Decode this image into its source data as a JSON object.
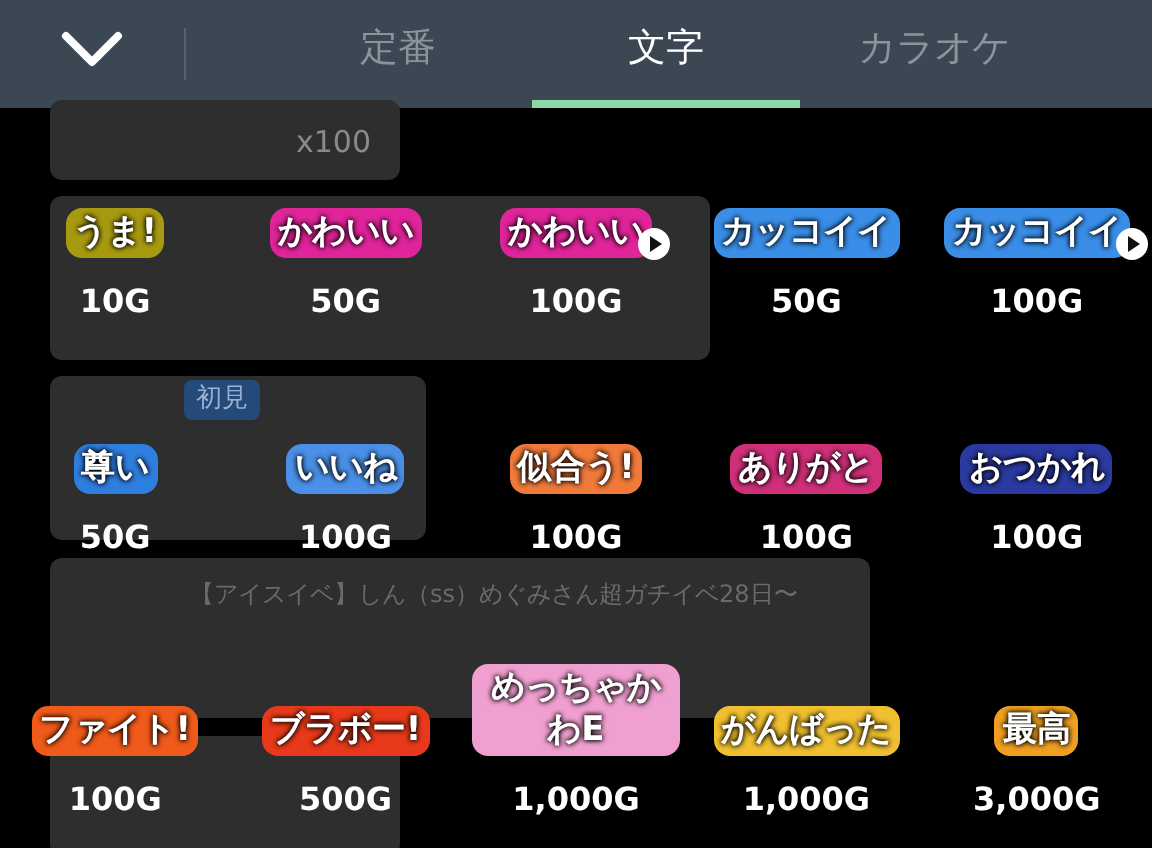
{
  "header": {
    "tabs": [
      {
        "label": "定番",
        "selected": false
      },
      {
        "label": "文字",
        "selected": true
      },
      {
        "label": "カラオケ",
        "selected": false
      }
    ]
  },
  "background_comments": [
    {
      "kind": "count",
      "text": "x100"
    },
    {
      "kind": "badge",
      "text": "初見"
    },
    {
      "kind": "comment",
      "text": "【アイスイベ】しん（ss）めぐみさん超ガチイベ28日〜"
    }
  ],
  "gifts": [
    {
      "sticker": "うま!",
      "color": "#a89a10",
      "price": "10G",
      "preview": false
    },
    {
      "sticker": "かわいい",
      "color": "#e0249a",
      "price": "50G",
      "preview": false
    },
    {
      "sticker": "かわいい",
      "color": "#e0249a",
      "price": "100G",
      "preview": true
    },
    {
      "sticker": "カッコイイ",
      "color": "#3a8ee8",
      "price": "50G",
      "preview": false
    },
    {
      "sticker": "カッコイイ",
      "color": "#3a8ee8",
      "price": "100G",
      "preview": true
    },
    {
      "sticker": "尊い",
      "color": "#2f7fe0",
      "price": "50G",
      "preview": false
    },
    {
      "sticker": "いいね",
      "color": "#4a90e8",
      "price": "100G",
      "preview": false
    },
    {
      "sticker": "似合う!",
      "color": "#f07a3a",
      "price": "100G",
      "preview": false
    },
    {
      "sticker": "ありがと",
      "color": "#d0307a",
      "price": "100G",
      "preview": false
    },
    {
      "sticker": "おつかれ",
      "color": "#2a3aa0",
      "price": "100G",
      "preview": false
    },
    {
      "sticker": "ファイト!",
      "color": "#f05a1a",
      "price": "100G",
      "preview": false
    },
    {
      "sticker": "ブラボー!",
      "color": "#e83a1a",
      "price": "500G",
      "preview": false
    },
    {
      "sticker": "めっちゃかわE",
      "color": "#f0a0d0",
      "price": "1,000G",
      "preview": false
    },
    {
      "sticker": "がんばった",
      "color": "#f0c030",
      "price": "1,000G",
      "preview": false
    },
    {
      "sticker": "最高",
      "color": "#f0a020",
      "price": "3,000G",
      "preview": false
    }
  ]
}
